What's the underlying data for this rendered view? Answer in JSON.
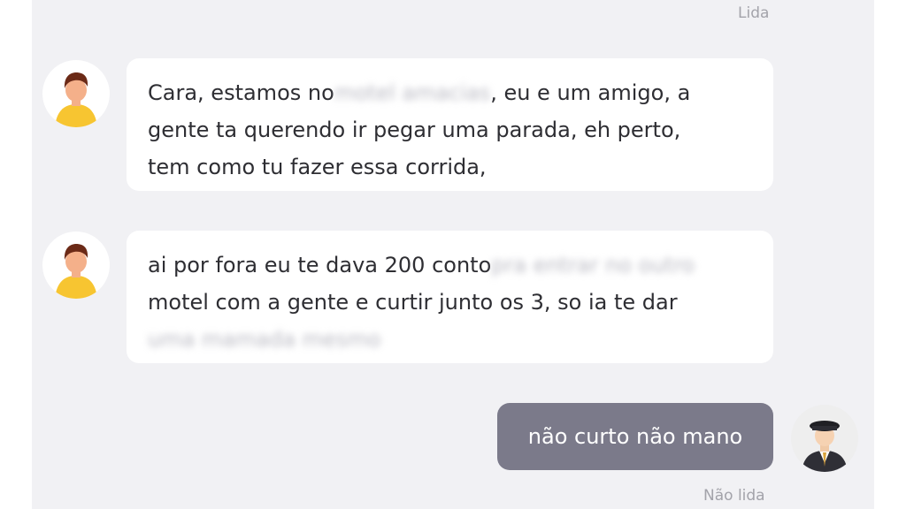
{
  "chat": {
    "status_top": "Lida",
    "status_bottom": "Não lida",
    "messages": [
      {
        "direction": "incoming",
        "lines": [
          {
            "a": "Cara, estamos no",
            "redacted": "motel amacias",
            "b": ", eu e um amigo, a"
          },
          {
            "text": "gente ta querendo ir pegar uma parada, eh perto,"
          },
          {
            "text": "tem como tu fazer essa corrida,"
          }
        ]
      },
      {
        "direction": "incoming",
        "lines": [
          {
            "a": "ai por fora eu te dava 200 conto",
            "redacted": "pra entrar no outro"
          },
          {
            "text": "motel com a gente e curtir junto os 3, so ia te dar"
          },
          {
            "redacted": "uma mamada mesmo"
          }
        ]
      },
      {
        "direction": "outgoing",
        "text": "não curto não mano"
      }
    ]
  },
  "colors": {
    "panel_bg": "#f1f1f4",
    "incoming_bubble": "#ffffff",
    "outgoing_bubble": "#7b7a8a",
    "status_text": "#a3a3aa"
  },
  "icons": {
    "passenger_avatar": "person-avatar-icon",
    "driver_avatar": "driver-avatar-icon"
  }
}
